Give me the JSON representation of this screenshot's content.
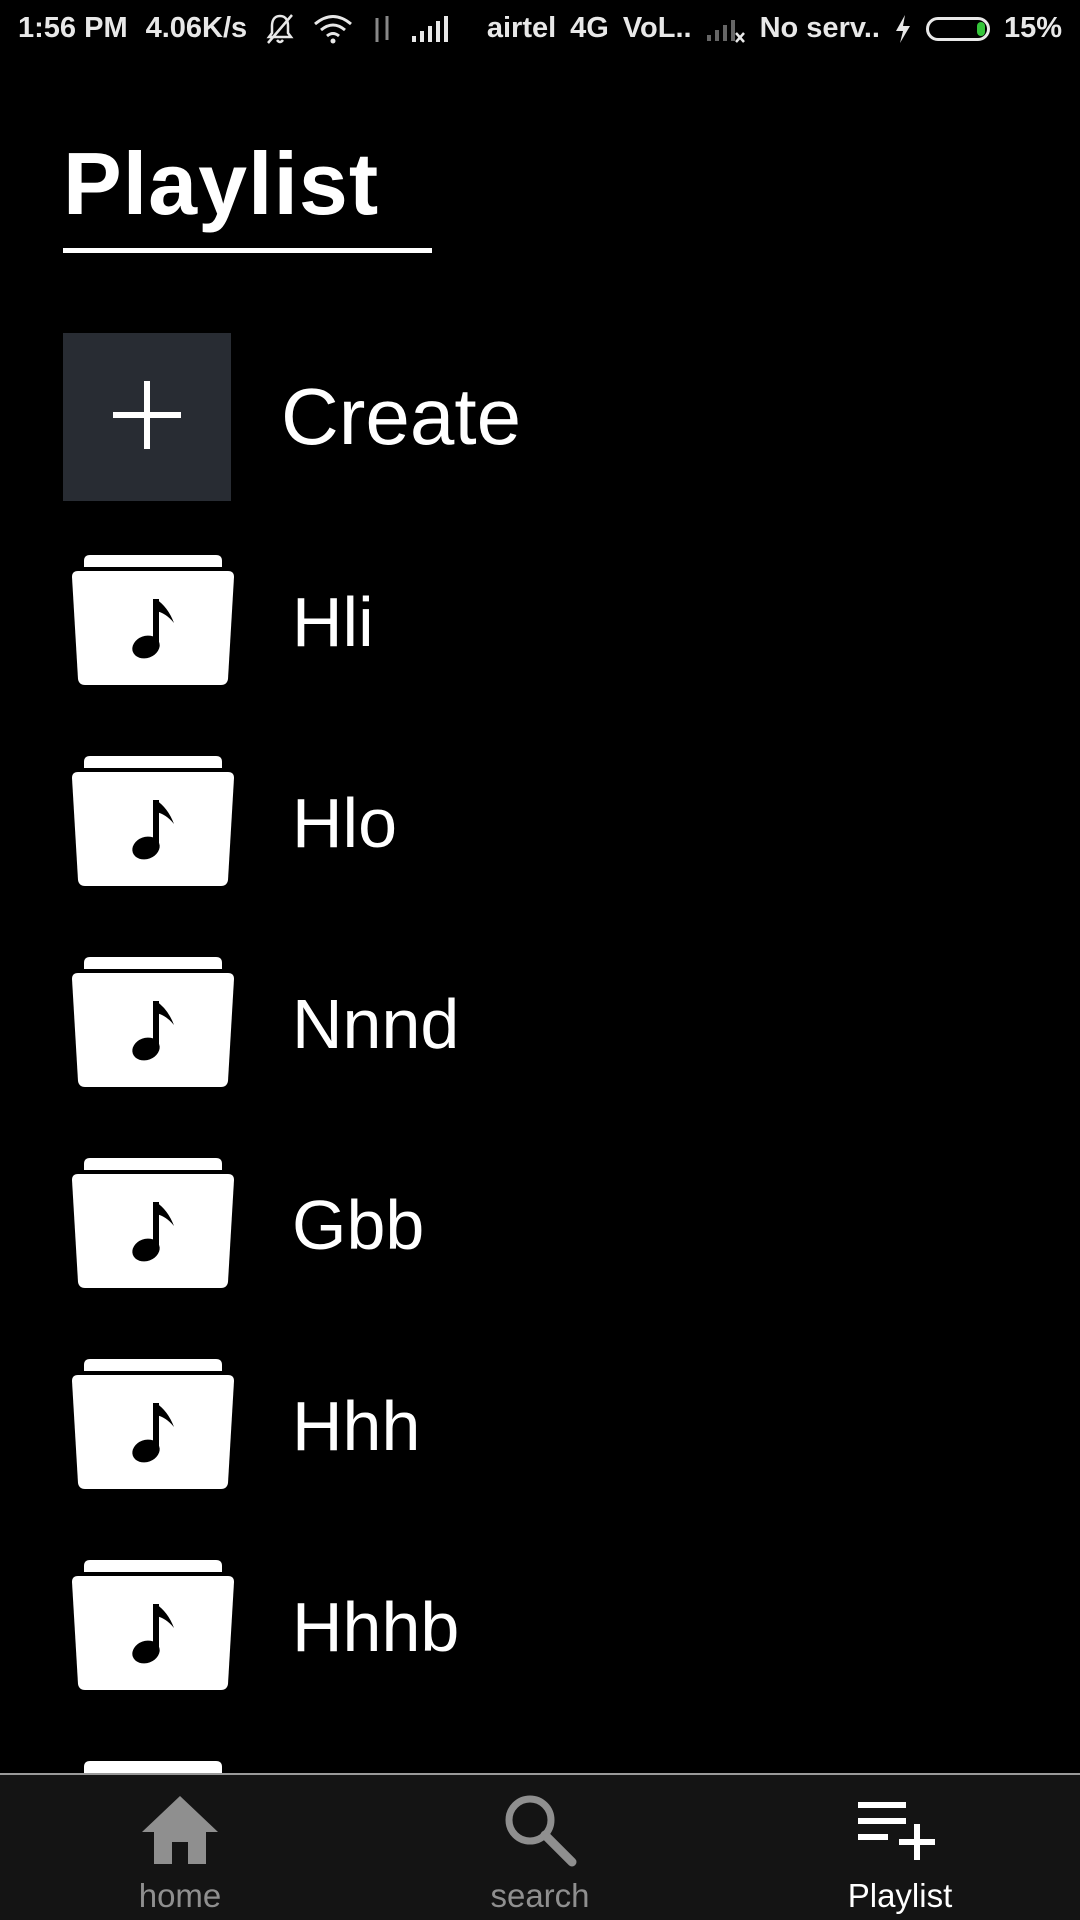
{
  "status_bar": {
    "time": "1:56 PM",
    "speed": "4.06K/s",
    "carrier": "airtel",
    "network": "4G",
    "volte": "VoL..",
    "service": "No serv..",
    "battery_percent": "15%",
    "battery_level": 0.15,
    "icons": [
      "bell-muted-icon",
      "wifi-icon",
      "data-arrows-icon",
      "signal-icon",
      "signal-x-icon",
      "charging-icon",
      "battery-icon"
    ]
  },
  "header": {
    "title": "Playlist"
  },
  "create": {
    "label": "Create",
    "icon": "plus-icon",
    "tile_color": "#282c33"
  },
  "playlists": [
    {
      "name": "Hli"
    },
    {
      "name": "Hlo"
    },
    {
      "name": "Nnnd"
    },
    {
      "name": "Gbb"
    },
    {
      "name": "Hhh"
    },
    {
      "name": "Hhhb"
    },
    {
      "name": ""
    }
  ],
  "bottom_nav": {
    "tabs": [
      {
        "label": "home",
        "icon": "home-icon",
        "active": false
      },
      {
        "label": "search",
        "icon": "search-icon",
        "active": false
      },
      {
        "label": "Playlist",
        "icon": "playlist-add-icon",
        "active": true
      }
    ],
    "inactive_color": "#8f8f8f",
    "active_color": "#ffffff"
  }
}
